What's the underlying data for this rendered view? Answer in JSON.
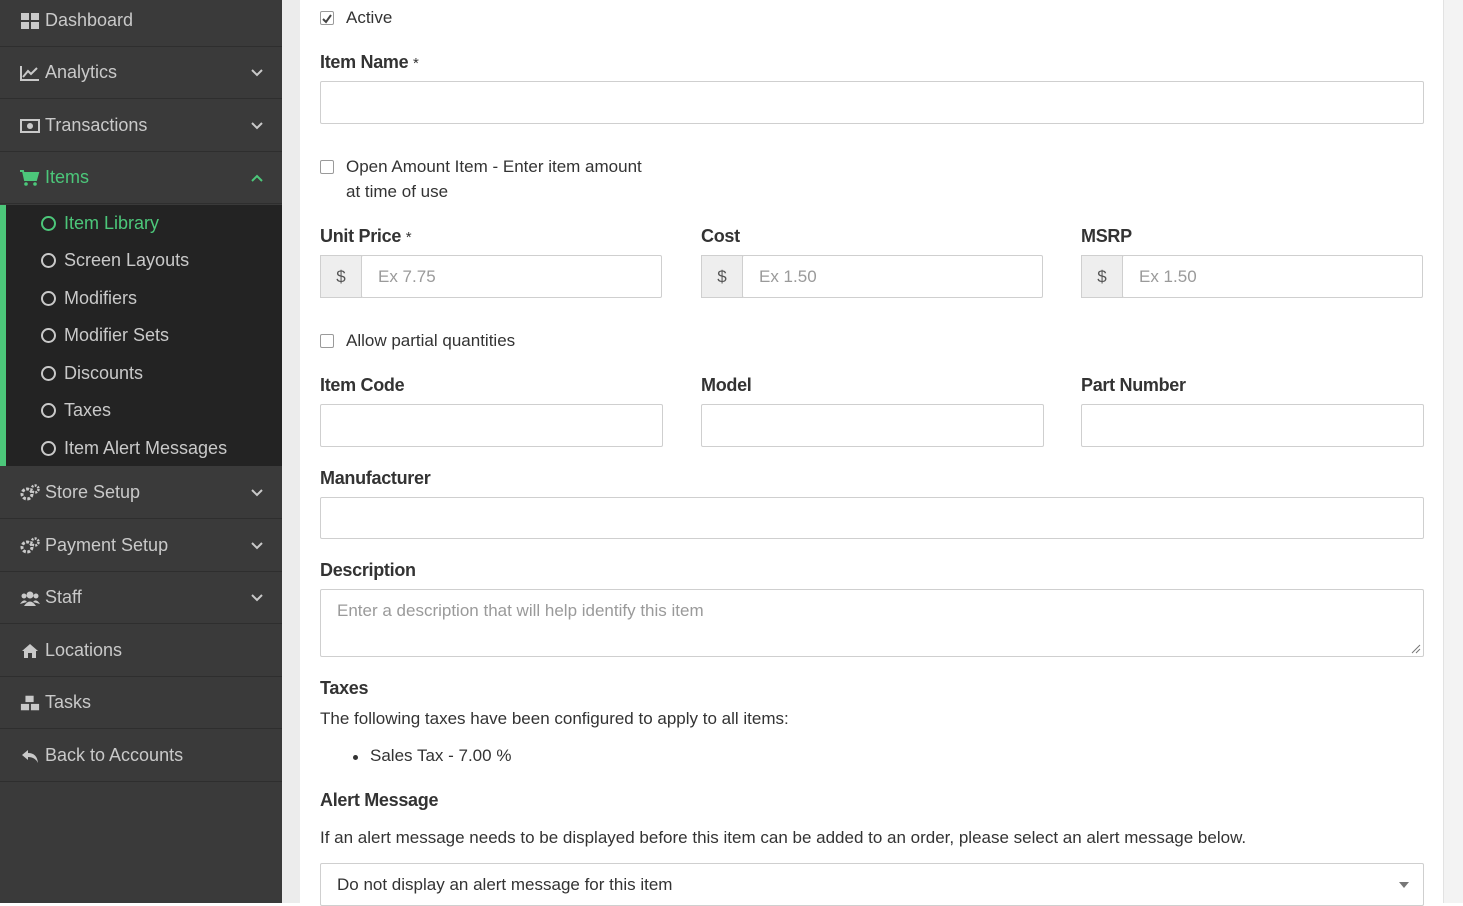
{
  "sidebar": {
    "items": [
      {
        "label": "Dashboard",
        "icon": "dashboard-icon"
      },
      {
        "label": "Analytics",
        "icon": "chart-line-icon"
      },
      {
        "label": "Transactions",
        "icon": "money-icon"
      },
      {
        "label": "Items",
        "icon": "cart-icon"
      },
      {
        "label": "Store Setup",
        "icon": "gears-icon"
      },
      {
        "label": "Payment Setup",
        "icon": "gears-icon"
      },
      {
        "label": "Staff",
        "icon": "users-icon"
      },
      {
        "label": "Locations",
        "icon": "home-icon"
      },
      {
        "label": "Tasks",
        "icon": "cubes-icon"
      },
      {
        "label": "Back to Accounts",
        "icon": "reply-icon"
      }
    ],
    "submenu": [
      {
        "label": "Item Library"
      },
      {
        "label": "Screen Layouts"
      },
      {
        "label": "Modifiers"
      },
      {
        "label": "Modifier Sets"
      },
      {
        "label": "Discounts"
      },
      {
        "label": "Taxes"
      },
      {
        "label": "Item Alert Messages"
      }
    ],
    "accent_color": "#4cc77a",
    "bg_color": "#3a3a3a"
  },
  "form": {
    "active_label": "Active",
    "active_checked": true,
    "item_name_label": "Item Name",
    "required_mark": "*",
    "item_name_value": "",
    "open_amount_label_line1": "Open Amount Item - Enter item amount",
    "open_amount_label_line2": "at time of use",
    "unit_price_label": "Unit Price",
    "unit_price_placeholder": "Ex 7.75",
    "cost_label": "Cost",
    "cost_placeholder": "Ex 1.50",
    "msrp_label": "MSRP",
    "msrp_placeholder": "Ex 1.50",
    "currency_symbol": "$",
    "partial_qty_label": "Allow partial quantities",
    "item_code_label": "Item Code",
    "model_label": "Model",
    "part_number_label": "Part Number",
    "manufacturer_label": "Manufacturer",
    "description_label": "Description",
    "description_placeholder": "Enter a description that will help identify this item",
    "taxes_heading": "Taxes",
    "taxes_text": "The following taxes have been configured to apply to all items:",
    "taxes_list": [
      "Sales Tax - 7.00 %"
    ],
    "alert_heading": "Alert Message",
    "alert_text": "If an alert message needs to be displayed before this item can be added to an order, please select an alert message below.",
    "alert_selected": "Do not display an alert message for this item"
  }
}
